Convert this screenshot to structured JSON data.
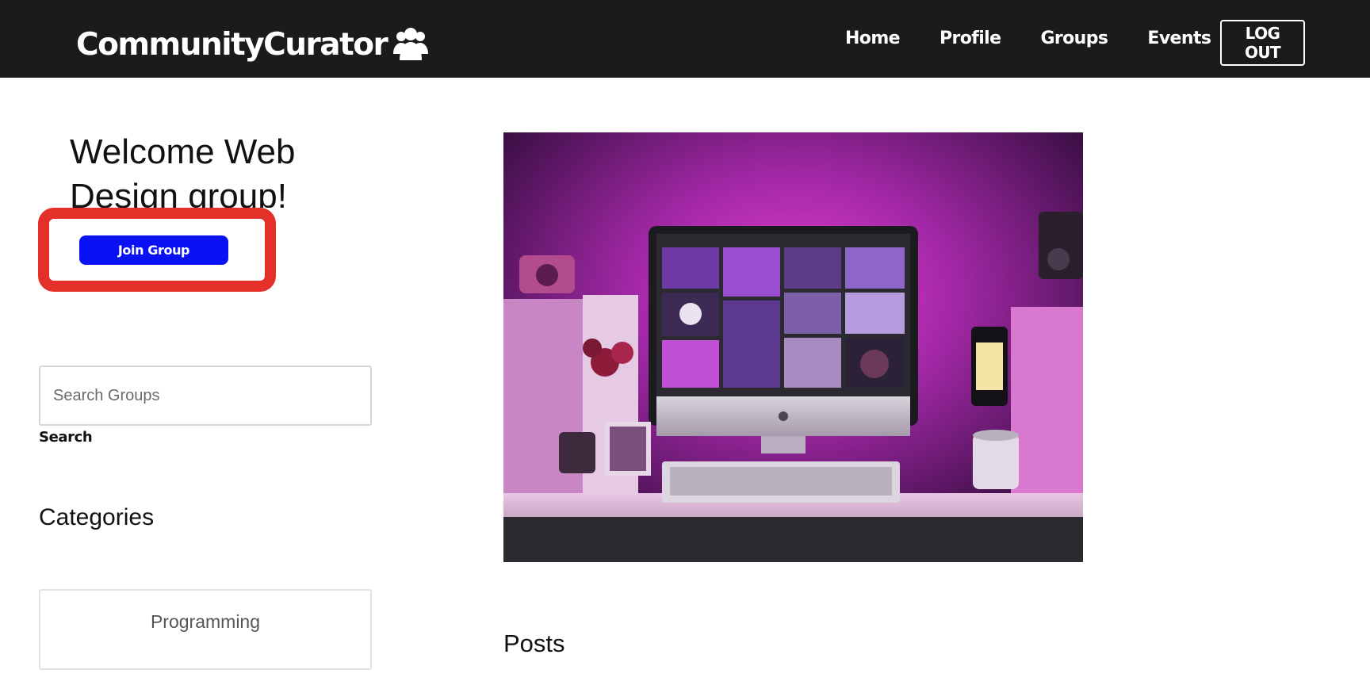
{
  "header": {
    "brand": "CommunityCurator",
    "brand_icon": "users-group-icon",
    "nav": [
      "Home",
      "Profile",
      "Groups",
      "Events"
    ],
    "logout_label": "LOG OUT"
  },
  "sidebar": {
    "welcome": "Welcome Web Design group!",
    "join_label": "Join Group",
    "search": {
      "placeholder": "Search Groups",
      "value": "",
      "button_label": "Search"
    },
    "categories_heading": "Categories",
    "categories": [
      "Programming"
    ]
  },
  "main": {
    "hero_image": "purple-lit-desk-with-imac-photo",
    "posts_heading": "Posts"
  },
  "colors": {
    "navbar": "#1c1a1a",
    "join_button": "#0a12f5",
    "highlight": "#e3312a"
  }
}
